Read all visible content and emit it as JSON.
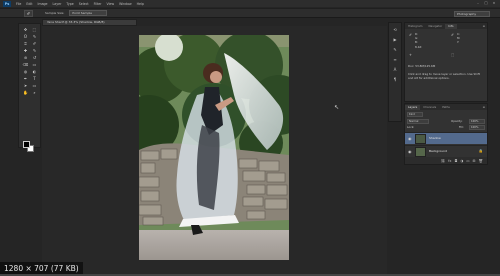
{
  "menubar": {
    "logo": "Ps",
    "items": [
      "File",
      "Edit",
      "Image",
      "Layer",
      "Type",
      "Select",
      "Filter",
      "View",
      "Window",
      "Help"
    ],
    "window_buttons": [
      "–",
      "□",
      "×"
    ]
  },
  "options": {
    "tool_preset_icon": "eyedropper-icon",
    "sample_size_label": "Sample Size:",
    "sample_size_value": "Point Sample",
    "workspace": "Photography"
  },
  "document": {
    "tab_title": "Yana Sharif @ 33.3% (Shadow, RGB/8)",
    "close": "×"
  },
  "tools": {
    "icons": [
      "move",
      "marquee",
      "lasso",
      "quick-select",
      "crop",
      "eyedropper",
      "healing",
      "brush",
      "clone",
      "history-brush",
      "eraser",
      "gradient",
      "blur",
      "dodge",
      "pen",
      "type",
      "path-select",
      "shape",
      "hand",
      "zoom"
    ],
    "glyphs": [
      "✥",
      "⬚",
      "ʘ",
      "✎",
      "⌗",
      "✐",
      "✚",
      "✎",
      "⊛",
      "↺",
      "⌫",
      "▭",
      "◍",
      "◐",
      "✒",
      "T",
      "➤",
      "▭",
      "✋",
      "⌕"
    ]
  },
  "right_strip": {
    "icons": [
      "history-icon",
      "actions-icon",
      "brush-presets-icon",
      "properties-icon",
      "character-icon",
      "paragraph-icon"
    ],
    "glyphs": [
      "⟲",
      "▶",
      "✎",
      "≡",
      "A",
      "¶"
    ]
  },
  "properties_panel": {
    "tabs": [
      "Histogram",
      "Navigator",
      "Info"
    ],
    "active_tab": "Info",
    "r_label": "R:",
    "c_label": "C:",
    "g_label": "G:",
    "m_label": "M:",
    "b_label": "B:",
    "y_label": "Y:",
    "bit_label": "8-bit",
    "doc_size": "Doc: 53.8M/125.6M",
    "hint": "Click and drag to move layer or selection. Use Shift and Alt for additional options."
  },
  "layers_panel": {
    "tabs": [
      "Layers",
      "Channels",
      "Paths"
    ],
    "active_tab": "Layers",
    "kind_filter": "Kind",
    "blend_mode": "Normal",
    "opacity_label": "Opacity:",
    "opacity_value": "100%",
    "lock_label": "Lock:",
    "fill_label": "Fill:",
    "fill_value": "100%",
    "layers": [
      {
        "name": "Shadow",
        "visible": true,
        "active": true,
        "locked": false
      },
      {
        "name": "Background",
        "visible": true,
        "active": false,
        "locked": true
      }
    ],
    "footer_icons": [
      "link-icon",
      "fx-icon",
      "mask-icon",
      "adjustment-icon",
      "folder-icon",
      "new-layer-icon",
      "trash-icon"
    ],
    "footer_glyphs": [
      "⛓",
      "fx",
      "◘",
      "◑",
      "▭",
      "⊞",
      "🗑"
    ]
  },
  "overlay": {
    "resolution_text": "1280 × 707 (77 KB)"
  },
  "playback": {
    "progress_fraction": 0.0
  },
  "colors": {
    "accent_selected_layer": "#536a8d",
    "panel_bg": "#323232",
    "app_bg": "#252525"
  }
}
